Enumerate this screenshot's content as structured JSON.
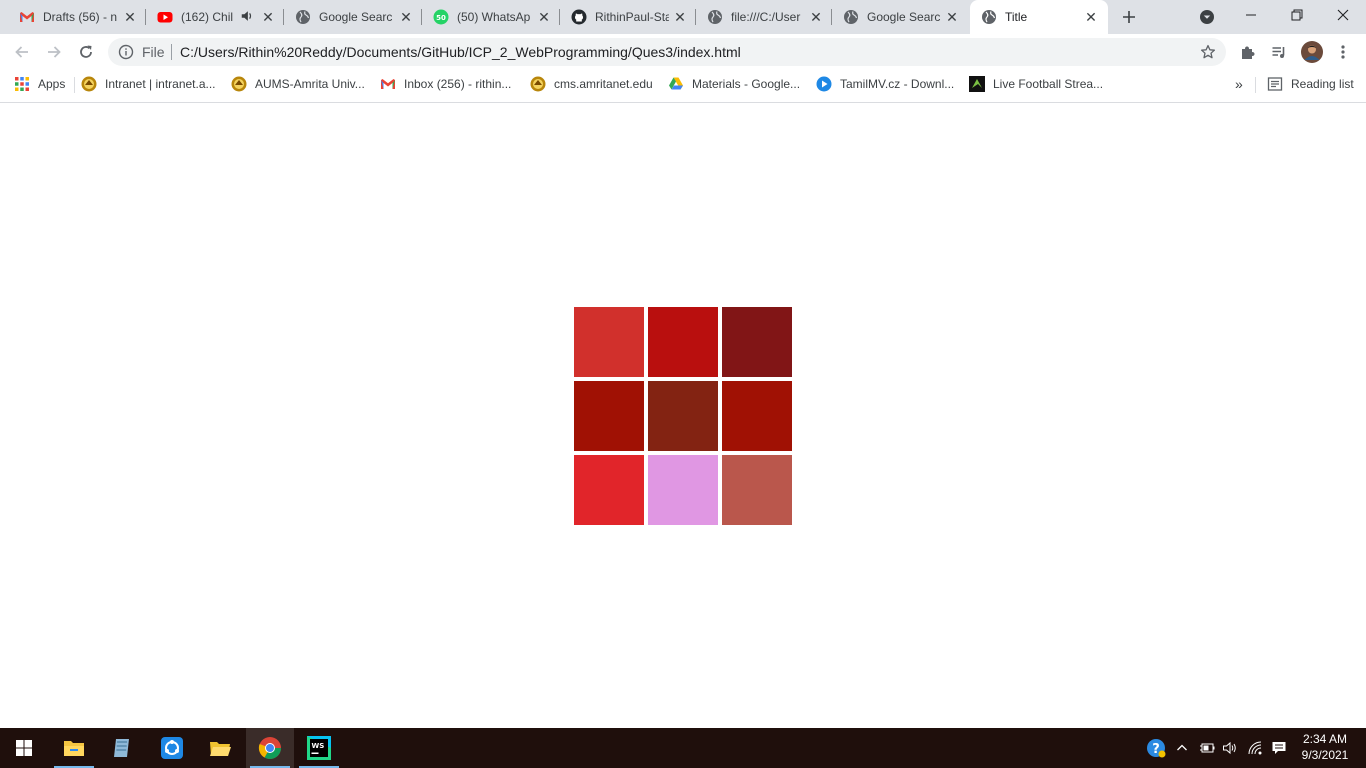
{
  "browser": {
    "tabs": [
      {
        "label": "Drafts (56) - n",
        "favicon": "gmail-icon"
      },
      {
        "label": "(162) Chil",
        "favicon": "youtube-icon",
        "audio": "speaker-icon"
      },
      {
        "label": "Google Searc",
        "favicon": "globe-icon"
      },
      {
        "label": "(50) WhatsAp",
        "favicon": "whatsapp-icon",
        "badge": "50"
      },
      {
        "label": "RithinPaul-Sta",
        "favicon": "github-icon"
      },
      {
        "label": "file:///C:/User",
        "favicon": "globe-icon"
      },
      {
        "label": "Google Searc",
        "favicon": "globe-icon"
      },
      {
        "label": "Title",
        "favicon": "globe-icon",
        "active": true
      }
    ],
    "new_tab_icon": "plus-icon",
    "address_bar": {
      "scheme_label": "File",
      "url": "C:/Users/Rithin%20Reddy/Documents/GitHub/ICP_2_WebProgramming/Ques3/index.html"
    },
    "bookmarks": [
      {
        "label": "Apps",
        "icon": "apps-grid-icon"
      },
      {
        "label": "Intranet | intranet.a...",
        "icon": "amrita-logo-icon"
      },
      {
        "label": "AUMS-Amrita Univ...",
        "icon": "amrita-logo-icon"
      },
      {
        "label": "Inbox (256) - rithin...",
        "icon": "gmail-icon"
      },
      {
        "label": "cms.amritanet.edu",
        "icon": "amrita-logo-icon"
      },
      {
        "label": "Materials - Google...",
        "icon": "google-drive-icon"
      },
      {
        "label": "TamilMV.cz - Downl...",
        "icon": "play-circle-icon"
      },
      {
        "label": "Live Football Strea...",
        "icon": "football-site-icon"
      }
    ],
    "overflow_label": "»",
    "reading_list_label": "Reading list"
  },
  "page": {
    "grid_colors": [
      "#d1302c",
      "#b90f0e",
      "#811516",
      "#a01104",
      "#832312",
      "#a01104",
      "#e1252a",
      "#e097e3",
      "#ba574c"
    ]
  },
  "taskbar": {
    "apps": [
      "file-explorer-icon",
      "notepad-icon",
      "sync-app-icon",
      "folder-icon",
      "chrome-icon",
      "webstorm-icon"
    ],
    "webstorm_label": "WS",
    "time": "2:34 AM",
    "date": "9/3/2021"
  }
}
